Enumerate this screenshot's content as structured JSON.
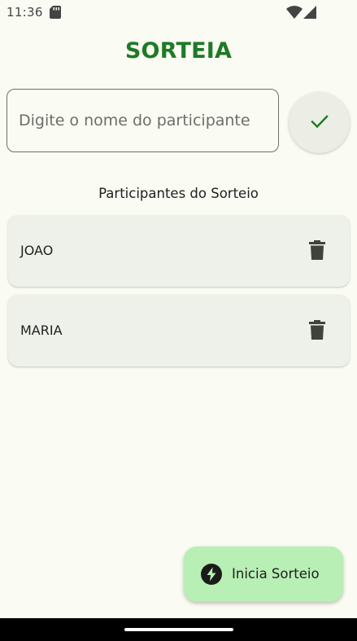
{
  "status_bar": {
    "time": "11:36",
    "icons": [
      "sd-card-icon",
      "wifi-icon",
      "signal-icon"
    ]
  },
  "app": {
    "title": "SORTEIA"
  },
  "input": {
    "value": "",
    "placeholder": "Digite o nome do participante",
    "confirm_icon": "check-icon"
  },
  "list": {
    "heading": "Participantes do Sorteio",
    "participants": [
      {
        "name": "JOAO",
        "action_icon": "trash-icon"
      },
      {
        "name": "MARIA",
        "action_icon": "trash-icon"
      }
    ]
  },
  "fab": {
    "label": "Inicia Sorteio",
    "icon": "bolt-icon"
  },
  "colors": {
    "background": "#fafbf3",
    "title": "#1e7a26",
    "card": "#eef1e9",
    "fab": "#b8efb5",
    "check": "#1e7a26"
  }
}
